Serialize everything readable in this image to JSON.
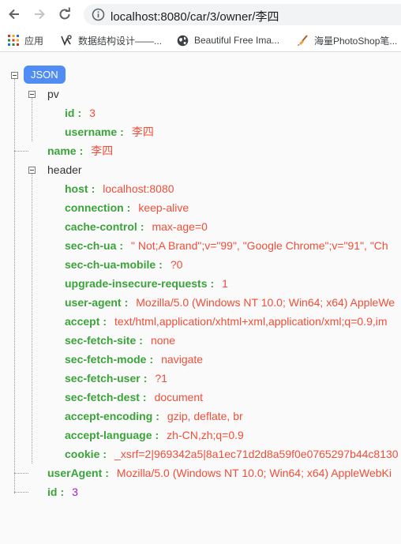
{
  "browser": {
    "url": "localhost:8080/car/3/owner/李四",
    "bookmarks": [
      {
        "label": "应用",
        "icon": "apps-grid-icon"
      },
      {
        "label": "数据结构设计——...",
        "icon": "bookmark-logo-icon"
      },
      {
        "label": "Beautiful Free Ima...",
        "icon": "globe-icon"
      },
      {
        "label": "海量PhotoShop笔...",
        "icon": "brush-icon"
      }
    ]
  },
  "json_viewer": {
    "root_label": "JSON",
    "pv": {
      "key": "pv",
      "id": {
        "key": "id",
        "value": "3"
      },
      "username": {
        "key": "username",
        "value": "李四"
      }
    },
    "name": {
      "key": "name",
      "value": "李四"
    },
    "header": {
      "key": "header",
      "entries": [
        {
          "key": "host",
          "value": "localhost:8080"
        },
        {
          "key": "connection",
          "value": "keep-alive"
        },
        {
          "key": "cache-control",
          "value": "max-age=0"
        },
        {
          "key": "sec-ch-ua",
          "value": "\" Not;A Brand\";v=\"99\", \"Google Chrome\";v=\"91\", \"Ch"
        },
        {
          "key": "sec-ch-ua-mobile",
          "value": "?0"
        },
        {
          "key": "upgrade-insecure-requests",
          "value": "1"
        },
        {
          "key": "user-agent",
          "value": "Mozilla/5.0 (Windows NT 10.0; Win64; x64) AppleWe"
        },
        {
          "key": "accept",
          "value": "text/html,application/xhtml+xml,application/xml;q=0.9,im"
        },
        {
          "key": "sec-fetch-site",
          "value": "none"
        },
        {
          "key": "sec-fetch-mode",
          "value": "navigate"
        },
        {
          "key": "sec-fetch-user",
          "value": "?1"
        },
        {
          "key": "sec-fetch-dest",
          "value": "document"
        },
        {
          "key": "accept-encoding",
          "value": "gzip, deflate, br"
        },
        {
          "key": "accept-language",
          "value": "zh-CN,zh;q=0.9"
        },
        {
          "key": "cookie",
          "value": "_xsrf=2|969342a5|8a1ec71d2d8a59f0e0765297b44c8130"
        }
      ]
    },
    "userAgent": {
      "key": "userAgent",
      "value": "Mozilla/5.0 (Windows NT 10.0; Win64; x64) AppleWebKi"
    },
    "id": {
      "key": "id",
      "value": "3"
    },
    "separator": ":"
  },
  "colors": {
    "key_green": "#3aa33a",
    "string_red": "#f04e38",
    "number_purple": "#a020c8",
    "root_badge_blue": "#4f8df5"
  }
}
